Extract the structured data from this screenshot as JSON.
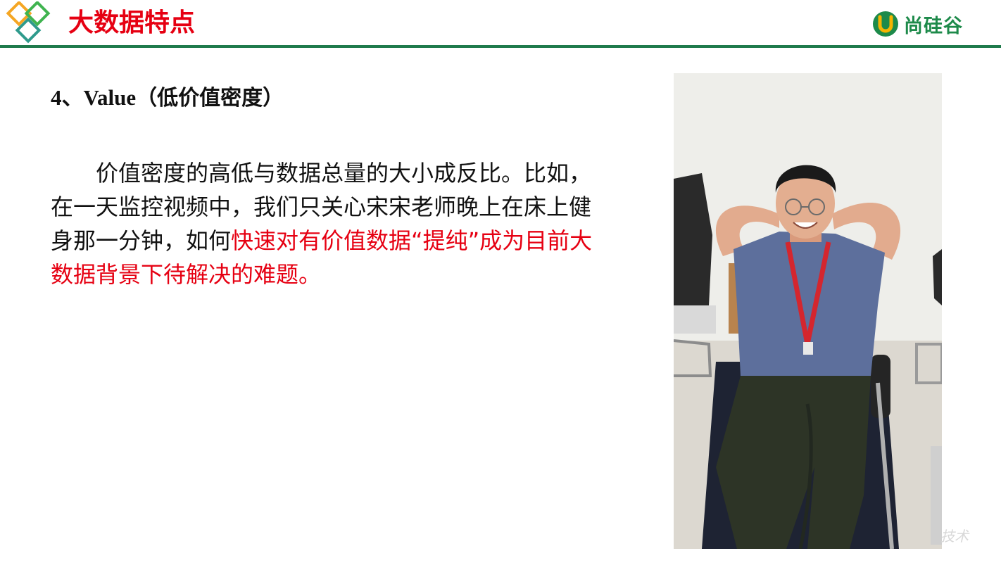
{
  "header": {
    "title": "大数据特点",
    "brand": "尚硅谷",
    "brand_color": "#1d8a4a",
    "title_color": "#e60012"
  },
  "content": {
    "subtitle_en": "4、Value",
    "subtitle_cn": "（低价值密度）",
    "paragraph_normal": "价值密度的高低与数据总量的大小成反比。比如，在一天监控视频中，我们只关心宋宋老师晚上在床上健身那一分钟，如何",
    "paragraph_highlight": "快速对有价值数据“提纯”成为目前大数据背景下待解决的难题。"
  },
  "watermark": "技术",
  "icons": [
    "diamond-logo-icon",
    "brand-u-icon"
  ]
}
